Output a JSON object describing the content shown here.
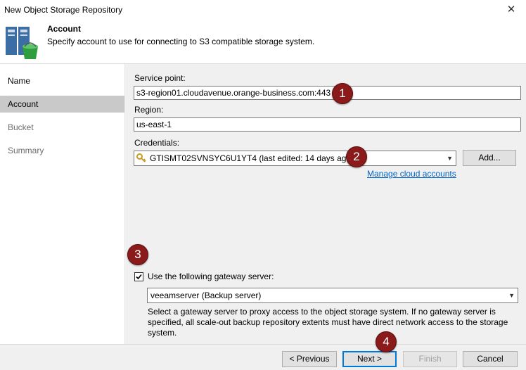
{
  "window": {
    "title": "New Object Storage Repository"
  },
  "header": {
    "title": "Account",
    "subtitle": "Specify account to use for connecting to S3 compatible storage system."
  },
  "sidebar": {
    "items": [
      {
        "label": "Name",
        "state": "normal"
      },
      {
        "label": "Account",
        "state": "active"
      },
      {
        "label": "Bucket",
        "state": "disabled"
      },
      {
        "label": "Summary",
        "state": "disabled"
      }
    ]
  },
  "form": {
    "service_point_label": "Service point:",
    "service_point_value": "s3-region01.cloudavenue.orange-business.com:443",
    "region_label": "Region:",
    "region_value": "us-east-1",
    "credentials_label": "Credentials:",
    "credentials_value": "GTISMT02SVNSYC6U1YT4 (last edited: 14 days ago)",
    "add_button": "Add...",
    "manage_link": "Manage cloud accounts",
    "gateway_checkbox_label": "Use the following gateway server:",
    "gateway_checked": true,
    "gateway_value": "veeamserver (Backup server)",
    "gateway_description": "Select a gateway server to proxy access to the object storage system. If no gateway server is specified, all scale-out backup repository extents must have direct network access to the storage system."
  },
  "annotations": [
    "1",
    "2",
    "3",
    "4"
  ],
  "footer": {
    "previous": "< Previous",
    "next": "Next >",
    "finish": "Finish",
    "cancel": "Cancel"
  },
  "colors": {
    "badge": "#8b1a1a",
    "link": "#0066cc",
    "sidebar_active": "#c9c9c9",
    "panel_bg": "#f0f0f0",
    "bucket_green": "#2e9e3e"
  },
  "icons": {
    "header": "object-storage-bucket-icon",
    "credentials": "key-icon"
  }
}
